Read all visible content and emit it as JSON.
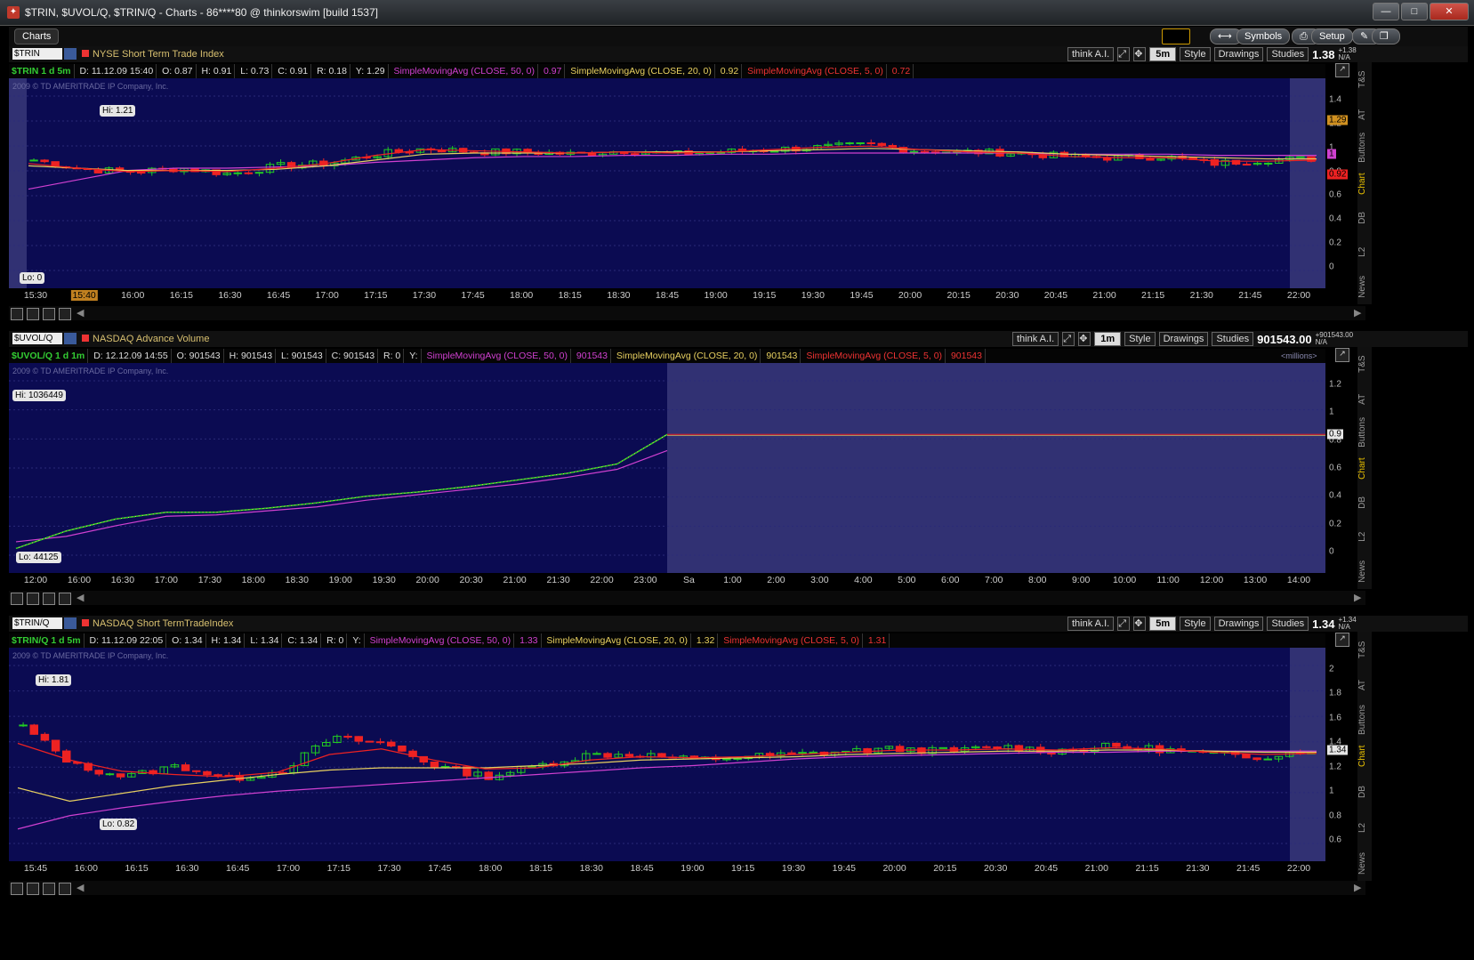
{
  "window": {
    "title": "$TRIN, $UVOL/Q, $TRIN/Q - Charts - 86****80 @ thinkorswim [build 1537]",
    "buttons": [
      "—",
      "□",
      "✕"
    ]
  },
  "toolbar": {
    "tab": "Charts",
    "symbols_label": "Symbols",
    "setup_label": "Setup"
  },
  "side_tabs": [
    "T&S",
    "AT",
    "Buttons",
    "Chart",
    "DB",
    "L2",
    "News"
  ],
  "common": {
    "think_ai": "think A.I.",
    "style": "Style",
    "drawings": "Drawings",
    "studies": "Studies",
    "copyright": "2009 © TD AMERITRADE IP Company, Inc.",
    "y_label": "Y:",
    "sma50": "SimpleMovingAvg (CLOSE, 50, 0)",
    "sma20": "SimpleMovingAvg (CLOSE, 20, 0)",
    "sma5": "SimpleMovingAvg (CLOSE, 5, 0)"
  },
  "panels": [
    {
      "symbol": "$TRIN",
      "description": "NYSE Short Term Trade Index",
      "timeframe": "5m",
      "last": "1.38",
      "last_sub": [
        "+1.38",
        "N/A"
      ],
      "info": {
        "sym": "$TRIN 1 d 5m",
        "d": "D: 11.12.09 15:40",
        "o": "O: 0.87",
        "h": "H: 0.91",
        "l": "L: 0.73",
        "c": "C: 0.91",
        "r": "R: 0.18",
        "y": "Y: 1.29",
        "sma50v": "0.97",
        "sma20v": "0.92",
        "sma5v": "0.72"
      },
      "hi_label": "Hi: 1.21",
      "lo_label": "Lo: 0",
      "y_ticks": [
        "1.4",
        "1.2",
        "1",
        "0.8",
        "0.6",
        "0.4",
        "0.2",
        "0"
      ],
      "y_badges": [
        "1.29",
        "1",
        "0.92"
      ],
      "x_ticks": [
        "15:30",
        "15:40",
        "16:00",
        "16:15",
        "16:30",
        "16:45",
        "17:00",
        "17:15",
        "17:30",
        "17:45",
        "18:00",
        "18:15",
        "18:30",
        "18:45",
        "19:00",
        "19:15",
        "19:30",
        "19:45",
        "20:00",
        "20:15",
        "20:30",
        "20:45",
        "21:00",
        "21:15",
        "21:30",
        "21:45",
        "22:00"
      ]
    },
    {
      "symbol": "$UVOL/Q",
      "description": "NASDAQ Advance Volume",
      "timeframe": "1m",
      "last": "901543.00",
      "last_sub": [
        "+901543.00",
        "N/A"
      ],
      "info": {
        "sym": "$UVOL/Q 1 d 1m",
        "d": "D: 12.12.09 14:55",
        "o": "O: 901543",
        "h": "H: 901543",
        "l": "L: 901543",
        "c": "C: 901543",
        "r": "R: 0",
        "y": "Y:",
        "sma50v": "901543",
        "sma20v": "901543",
        "sma5v": "901543"
      },
      "unit_note": "<millions>",
      "hi_label": "Hi: 1036449",
      "lo_label": "Lo: 44125",
      "y_ticks": [
        "1.2",
        "1",
        "0.8",
        "0.6",
        "0.4",
        "0.2",
        "0"
      ],
      "y_badges": [
        "0.9"
      ],
      "x_ticks": [
        "12:00",
        "16:00",
        "16:30",
        "17:00",
        "17:30",
        "18:00",
        "18:30",
        "19:00",
        "19:30",
        "20:00",
        "20:30",
        "21:00",
        "21:30",
        "22:00",
        "23:00",
        "Sa",
        "1:00",
        "2:00",
        "3:00",
        "4:00",
        "5:00",
        "6:00",
        "7:00",
        "8:00",
        "9:00",
        "10:00",
        "11:00",
        "12:00",
        "13:00",
        "14:00"
      ]
    },
    {
      "symbol": "$TRIN/Q",
      "description": "NASDAQ Short TermTradeIndex",
      "timeframe": "5m",
      "last": "1.34",
      "last_sub": [
        "+1.34",
        "N/A"
      ],
      "info": {
        "sym": "$TRIN/Q 1 d 5m",
        "d": "D: 11.12.09 22:05",
        "o": "O: 1.34",
        "h": "H: 1.34",
        "l": "L: 1.34",
        "c": "C: 1.34",
        "r": "R: 0",
        "y": "Y:",
        "sma50v": "1.33",
        "sma20v": "1.32",
        "sma5v": "1.31"
      },
      "hi_label": "Hi: 1.81",
      "lo_label": "Lo: 0.82",
      "y_ticks": [
        "2",
        "1.8",
        "1.6",
        "1.4",
        "1.2",
        "1",
        "0.8",
        "0.6"
      ],
      "y_badges": [
        "1.34"
      ],
      "x_ticks": [
        "15:45",
        "16:00",
        "16:15",
        "16:30",
        "16:45",
        "17:00",
        "17:15",
        "17:30",
        "17:45",
        "18:00",
        "18:15",
        "18:30",
        "18:45",
        "19:00",
        "19:15",
        "19:30",
        "19:45",
        "20:00",
        "20:15",
        "20:30",
        "20:45",
        "21:00",
        "21:15",
        "21:30",
        "21:45",
        "22:00"
      ]
    }
  ],
  "colors": {
    "chart_bg": "#0b0b52",
    "up": "#22cc22",
    "down": "#ee2222",
    "sma50": "#d040d0",
    "sma20": "#e8d060",
    "sma5": "#ee2222"
  },
  "chart_data": [
    {
      "type": "candlestick",
      "title": "NYSE Short Term Trade Index",
      "ylim": [
        0,
        1.5
      ],
      "x": [
        "15:30",
        "15:40",
        "16:00",
        "16:15",
        "16:30",
        "16:45",
        "17:00",
        "17:15",
        "17:30",
        "17:45",
        "18:00",
        "18:15",
        "18:30",
        "18:45",
        "19:00",
        "19:15",
        "19:30",
        "19:45",
        "20:00",
        "20:15",
        "20:30",
        "20:45",
        "21:00",
        "21:15",
        "21:30",
        "21:45",
        "22:00"
      ],
      "close": [
        0.95,
        0.87,
        0.85,
        0.88,
        0.83,
        0.9,
        0.92,
        1.0,
        1.05,
        1.02,
        1.02,
        1.0,
        1.03,
        1.0,
        1.02,
        1.04,
        1.06,
        1.08,
        1.03,
        1.02,
        1.01,
        0.98,
        0.97,
        0.98,
        0.92,
        0.95,
        0.96
      ],
      "sma50": [
        0.7,
        0.78,
        0.86,
        0.88,
        0.88,
        0.89,
        0.9,
        0.93,
        0.95,
        0.97,
        0.98,
        0.98,
        0.99,
        0.99,
        1.0,
        1.0,
        1.01,
        1.01,
        1.01,
        1.01,
        1.01,
        1.0,
        1.0,
        1.0,
        0.99,
        0.99,
        0.99
      ],
      "sma20": [
        0.9,
        0.88,
        0.86,
        0.86,
        0.86,
        0.87,
        0.9,
        0.95,
        1.0,
        1.01,
        1.01,
        1.01,
        1.02,
        1.02,
        1.02,
        1.03,
        1.04,
        1.05,
        1.04,
        1.03,
        1.02,
        1.0,
        0.99,
        0.98,
        0.97,
        0.96,
        0.96
      ],
      "sma5": [
        0.92,
        0.88,
        0.85,
        0.86,
        0.85,
        0.88,
        0.92,
        0.99,
        1.04,
        1.03,
        1.02,
        1.01,
        1.02,
        1.01,
        1.02,
        1.04,
        1.06,
        1.07,
        1.04,
        1.02,
        1.01,
        0.98,
        0.97,
        0.97,
        0.94,
        0.94,
        0.95
      ]
    },
    {
      "type": "line",
      "title": "NASDAQ Advance Volume",
      "ylabel": "<millions>",
      "ylim": [
        0,
        1.3
      ],
      "x": [
        "12:00",
        "16:00",
        "16:30",
        "17:00",
        "17:30",
        "18:00",
        "18:30",
        "19:00",
        "19:30",
        "20:00",
        "20:30",
        "21:00",
        "21:30",
        "22:00"
      ],
      "close": [
        0.05,
        0.18,
        0.27,
        0.32,
        0.32,
        0.35,
        0.39,
        0.44,
        0.47,
        0.51,
        0.56,
        0.61,
        0.68,
        0.9
      ],
      "sma50": [
        0.1,
        0.14,
        0.22,
        0.29,
        0.3,
        0.33,
        0.36,
        0.41,
        0.45,
        0.49,
        0.53,
        0.58,
        0.64,
        0.78
      ],
      "last": 0.9
    },
    {
      "type": "candlestick",
      "title": "NASDAQ Short TermTradeIndex",
      "ylim": [
        0.5,
        2.1
      ],
      "x": [
        "15:45",
        "16:00",
        "16:15",
        "16:30",
        "16:45",
        "17:00",
        "17:15",
        "17:30",
        "17:45",
        "18:00",
        "18:15",
        "18:30",
        "18:45",
        "19:00",
        "19:15",
        "19:30",
        "19:45",
        "20:00",
        "20:15",
        "20:30",
        "20:45",
        "21:00",
        "21:15",
        "21:30",
        "21:45",
        "22:00"
      ],
      "close": [
        1.55,
        1.2,
        1.1,
        1.2,
        1.08,
        1.15,
        1.45,
        1.4,
        1.2,
        1.1,
        1.2,
        1.3,
        1.3,
        1.25,
        1.28,
        1.3,
        1.33,
        1.35,
        1.33,
        1.37,
        1.33,
        1.37,
        1.35,
        1.3,
        1.28,
        1.34
      ],
      "sma50": [
        0.63,
        0.75,
        0.82,
        0.88,
        0.93,
        0.97,
        1.0,
        1.03,
        1.06,
        1.09,
        1.12,
        1.15,
        1.18,
        1.2,
        1.23,
        1.26,
        1.28,
        1.29,
        1.3,
        1.31,
        1.32,
        1.32,
        1.33,
        1.33,
        1.33,
        1.33
      ],
      "sma20": [
        1.0,
        0.88,
        0.95,
        1.02,
        1.07,
        1.12,
        1.16,
        1.18,
        1.18,
        1.18,
        1.2,
        1.22,
        1.25,
        1.26,
        1.27,
        1.28,
        1.3,
        1.31,
        1.32,
        1.33,
        1.33,
        1.34,
        1.34,
        1.33,
        1.32,
        1.32
      ],
      "sma5": [
        1.4,
        1.25,
        1.15,
        1.12,
        1.1,
        1.14,
        1.3,
        1.35,
        1.25,
        1.17,
        1.18,
        1.25,
        1.28,
        1.27,
        1.28,
        1.3,
        1.32,
        1.34,
        1.34,
        1.35,
        1.34,
        1.36,
        1.35,
        1.32,
        1.3,
        1.31
      ]
    }
  ]
}
